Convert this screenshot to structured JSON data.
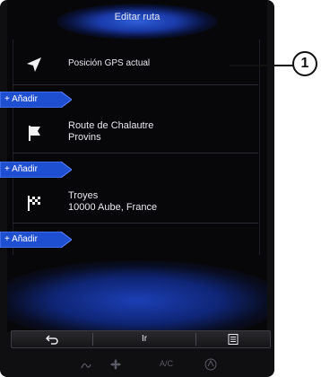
{
  "header": {
    "title": "Editar ruta"
  },
  "route": {
    "start": {
      "label": "Posición GPS actual"
    },
    "add_label_1": "+ Añadir",
    "waypoint": {
      "line1": "Route de Chalautre",
      "line2": "Provins"
    },
    "add_label_2": "+ Añadir",
    "destination": {
      "line1": "Troyes",
      "line2": "10000 Aube, France"
    },
    "add_label_3": "+ Añadir"
  },
  "toolbar": {
    "go_label": "Ir"
  },
  "climate": {
    "ac_label": "A/C"
  },
  "callout": {
    "number": "1"
  },
  "colors": {
    "accent_blue": "#1f4fd1",
    "background": "#07070a"
  }
}
